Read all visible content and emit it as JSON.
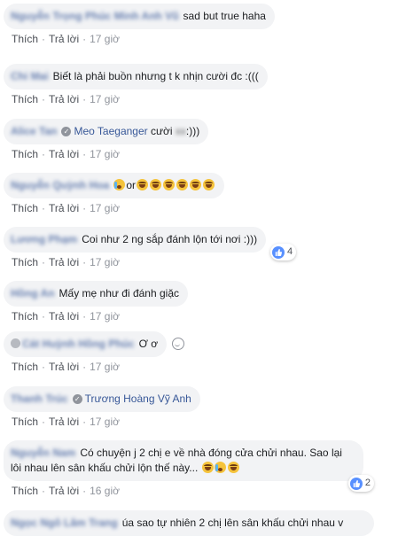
{
  "actions": {
    "like": "Thích",
    "reply": "Trả lời",
    "sep": "·"
  },
  "comments": [
    {
      "author": "Nguyễn Trọng Phúc Minh Anh Vũ",
      "text": "sad but true haha",
      "time": "17 giờ"
    },
    {
      "author": "Chi Mai",
      "text": "Biết là phải buồn nhưng t k nhịn cười đc :(((",
      "time": "17 giờ"
    },
    {
      "author": "Alice Tan",
      "mention": "Meo Taeganger",
      "text": "cười",
      "text_after": ":)))",
      "time": "17 giờ"
    },
    {
      "author": "Nguyễn Quỳnh Hoa",
      "text": "or",
      "time": "17 giờ"
    },
    {
      "author": "Lương Phạm",
      "text": "Coi như 2 ng sắp đánh lộn tới nơi :)))",
      "time": "17 giờ",
      "reaction_count": "4"
    },
    {
      "author": "Hồng An",
      "text": "Mấy mẹ như đi đánh giặc",
      "time": "17 giờ"
    },
    {
      "author": "Cát Huỳnh Hồng Phúc",
      "text": "Ơ ơ",
      "time": "17 giờ"
    },
    {
      "author": "Thanh Trúc",
      "mention": "Trương Hoàng Vỹ Anh",
      "time": "17 giờ"
    },
    {
      "author": "Nguyễn Nam",
      "text": "Có chuyện j 2 chị e về nhà đóng cửa chửi nhau. Sao lại lôi nhau lên sân khấu chửi lộn thế này...",
      "time": "16 giờ",
      "reaction_count": "2"
    },
    {
      "author": "Ngọc Ngô Lâm Trang",
      "text": "úa sao tự nhiên 2 chị lên sân khấu chửi nhau v"
    }
  ],
  "colors": {
    "bubble": "#f2f3f5",
    "link": "#385898",
    "meta": "#90949c",
    "like": "#5890ff"
  }
}
